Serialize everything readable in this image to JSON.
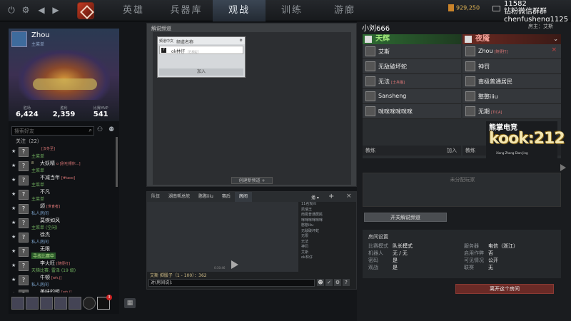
{
  "topbar": {
    "tabs": [
      "英雄",
      "兵器库",
      "观战",
      "训练",
      "游廊"
    ],
    "active_tab": 2,
    "gold": "929,250",
    "overlay": [
      "11582",
      "钻粉微信群群",
      "chenfusheng1125"
    ]
  },
  "profile": {
    "name": "Zhou",
    "subtitle": "主菜单",
    "stats": [
      {
        "label": "胜场",
        "value": "6,424"
      },
      {
        "label": "胜利",
        "value": "2,359"
      },
      {
        "label": "比赛MVP",
        "value": "541"
      }
    ]
  },
  "friends": {
    "search_placeholder": "搜索好友",
    "section": "关注（22）",
    "items": [
      {
        "level": "",
        "name": "",
        "tag": "[汉冬至]",
        "status": "主菜单",
        "status_type": "online"
      },
      {
        "level": "8",
        "name": "大妖精",
        "tag": "o [别吐槽你…]",
        "status": "主菜单",
        "status_type": "online"
      },
      {
        "level": "",
        "name": "不减当年",
        "tag": "[#taco]",
        "status": "主菜单",
        "status_type": "online"
      },
      {
        "level": "",
        "name": "不凡",
        "tag": "",
        "status": "主菜单",
        "status_type": "online"
      },
      {
        "level": "",
        "name": "颂",
        "tag": "[世食者]",
        "status": "私人房间",
        "status_type": "lobby"
      },
      {
        "level": "",
        "name": "莫疾如风",
        "tag": "",
        "status": "主菜单 (空闲)",
        "status_type": "online"
      },
      {
        "level": "",
        "name": "徐杰",
        "tag": "",
        "status": "私人房间",
        "status_type": "lobby"
      },
      {
        "level": "",
        "name": "无限",
        "tag": "",
        "status": "寻找比赛中",
        "status_type": "check"
      },
      {
        "level": "",
        "name": "李火旺",
        "tag": "[随便打]",
        "status": "天梯比赛: 雷泽 (19 级)",
        "status_type": "online"
      },
      {
        "level": "",
        "name": "牛顿",
        "tag": "[wh.j]",
        "status": "私人房间",
        "status_type": "lobby"
      },
      {
        "level": "",
        "name": "美味的蛆",
        "tag": "[wh.j]",
        "status": "私人房间",
        "status_type": "lobby"
      },
      {
        "level": "",
        "name": "宝贝儿",
        "tag": "",
        "status": "",
        "status_type": "online"
      }
    ],
    "badge_count": "3"
  },
  "center": {
    "title": "解说频道",
    "header_col1": "频道中文",
    "header_col2": "频道名称",
    "channel_name": "ok林仔",
    "channel_tag": "[已锁定]",
    "join_label": "加入",
    "create_label": "创建新频道 +"
  },
  "chat": {
    "tabs": [
      "队伍",
      "湖南帮总舵",
      "憨憨iiiu",
      "赛后",
      "房间"
    ],
    "active_tab": 4,
    "close": "×",
    "members": [
      "11名观众",
      "凯瑞王",
      "南极普通居民",
      "咪咪咪咪咪咪",
      "憨憨iiiu",
      "无敌破坏蛇",
      "无限",
      "无法",
      "神罚",
      "艾斯",
      "ok林仔"
    ],
    "time_label": "0:30:46",
    "line": "艾斯 掷骰子（1 - 100）：362",
    "input_prefix": "对(房间说):"
  },
  "room": {
    "title": "小刘666",
    "owner": "房主：艾斯",
    "radiant": {
      "name": "天辉",
      "players": [
        {
          "name": "艾斯",
          "tag": ""
        },
        {
          "name": "无敌破坏蛇",
          "tag": ""
        },
        {
          "name": "无法",
          "tag": "[士兵猫]"
        },
        {
          "name": "Sansheng",
          "tag": ""
        },
        {
          "name": "咪咪咪咪咪咪",
          "tag": ""
        }
      ],
      "coach": "教练",
      "join": "加入"
    },
    "dire": {
      "name": "夜魇",
      "players": [
        {
          "name": "Zhou",
          "tag": "[随便打]"
        },
        {
          "name": "神罚",
          "tag": ""
        },
        {
          "name": "南极普通居民",
          "tag": ""
        },
        {
          "name": "憨憨iiiu",
          "tag": ""
        },
        {
          "name": "无期",
          "tag": "[TICA]"
        }
      ],
      "coach": "教练",
      "join": "加入"
    },
    "unassigned": "未分配玩家",
    "toggle_button": "开关解说频道",
    "settings": {
      "title": "房间设置",
      "rows": [
        {
          "k": "比赛模式",
          "v": "队长模式"
        },
        {
          "k": "机器人",
          "v": "无 / 无"
        },
        {
          "k": "密码",
          "v": "是"
        },
        {
          "k": "观战",
          "v": "是"
        },
        {
          "k": "服务器",
          "v": "电信（浙江）"
        },
        {
          "k": "启用作弊",
          "v": "否"
        },
        {
          "k": "可见情况",
          "v": "公开"
        },
        {
          "k": "联赛",
          "v": "无"
        }
      ]
    },
    "leave_button": "离开这个房间"
  },
  "watermark": {
    "top": "熊掌电竞",
    "main": "kook:212",
    "sub": "Xiong Zhang Dian Jing"
  }
}
